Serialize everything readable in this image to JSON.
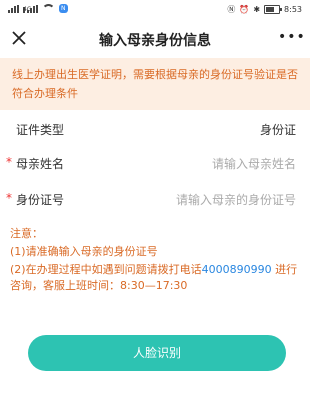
{
  "status_bar": {
    "network": "4G",
    "badge": "N",
    "battery": "43%",
    "time": "8:53"
  },
  "nav": {
    "title": "输入母亲身份信息",
    "more": "•••"
  },
  "notice": {
    "text": "线上办理出生医学证明，需要根据母亲的身份证号验证是否符合办理条件"
  },
  "form": {
    "cert_type": {
      "label": "证件类型",
      "value": "身份证"
    },
    "mother_name": {
      "required": "*",
      "label": "母亲姓名",
      "placeholder": "请输入母亲姓名"
    },
    "id_number": {
      "required": "*",
      "label": "身份证号",
      "placeholder": "请输入母亲的身份证号"
    }
  },
  "notes": {
    "title": "注意：",
    "item1": "(1)请准确输入母亲的身份证号",
    "item2_prefix": "(2)在办理过程中如遇到问题请拨打电话",
    "phone": "4000890990",
    "item2_suffix": " 进行咨询，客服上班时间：8:30—17:30"
  },
  "actions": {
    "face_recognition": "人脸识别"
  },
  "colors": {
    "accent": "#2dc3b2",
    "notice_bg": "#fdeee2",
    "notice_text": "#d96a26",
    "link": "#2a87e0",
    "required": "#e33333"
  }
}
